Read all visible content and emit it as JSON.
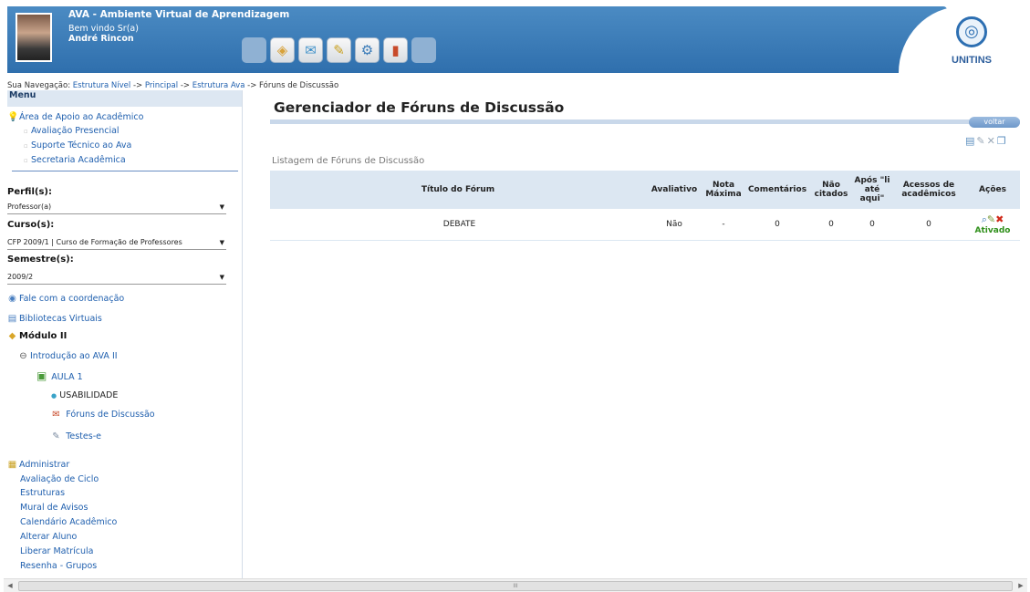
{
  "header": {
    "app_title": "AVA - Ambiente Virtual de Aprendizagem",
    "welcome": "Bem vindo Sr(a)",
    "user_name": "André Rincon",
    "logo_text": "UNITINS",
    "toolbar_icons": [
      "blank-icon",
      "tag-icon",
      "mail-icon",
      "tools-icon",
      "settings-icon",
      "book-icon",
      "blank-icon"
    ]
  },
  "breadcrumb": {
    "prefix": "Sua Navegação:",
    "items": [
      "Estrutura Nível",
      "Principal",
      "Estrutura Ava"
    ],
    "separator": "->",
    "current": "Fóruns de Discussão"
  },
  "sidebar": {
    "menu_title": "Menu",
    "support_title": "Área de Apoio ao Acadêmico",
    "support_items": [
      "Avaliação Presencial",
      "Suporte Técnico ao Ava",
      "Secretaria Acadêmica"
    ],
    "perfil_label": "Perfil(s):",
    "perfil_value": "Professor(a)",
    "curso_label": "Curso(s):",
    "curso_value": "CFP 2009/1 | Curso de Formação de Professores",
    "semestre_label": "Semestre(s):",
    "semestre_value": "2009/2",
    "fale": "Fale com a coordenação",
    "bibliotecas": "Bibliotecas Virtuais",
    "modulo": "Módulo II",
    "intro": "Introdução ao AVA II",
    "aula": "AULA 1",
    "usabilidade": "USABILIDADE",
    "foruns": "Fóruns de Discussão",
    "testes": "Testes-e",
    "admin_title": "Administrar",
    "admin_items": [
      "Avaliação de Ciclo",
      "Estruturas",
      "Mural de Avisos",
      "Calendário Acadêmico",
      "Alterar Aluno",
      "Liberar Matrícula",
      "Resenha - Grupos"
    ]
  },
  "main": {
    "title": "Gerenciador de Fóruns de Discussão",
    "voltar": "voltar",
    "list_title": "Listagem de Fóruns de Discussão",
    "columns": [
      "Título do Fórum",
      "Avaliativo",
      "Nota Máxima",
      "Comentários",
      "Não citados",
      "Após \"li até aqui\"",
      "Acessos de acadêmicos",
      "Ações"
    ],
    "rows": [
      {
        "titulo": "DEBATE",
        "avaliativo": "Não",
        "nota": "-",
        "comentarios": "0",
        "nao_citados": "0",
        "apos": "0",
        "acessos": "0",
        "status": "Ativado"
      }
    ]
  },
  "scrollbar": {
    "thumb_label": "III"
  },
  "colors": {
    "header_blue": "#3a7bb8",
    "table_header": "#dce7f2",
    "link": "#1f5fae",
    "status_green": "#2f8f1a"
  }
}
